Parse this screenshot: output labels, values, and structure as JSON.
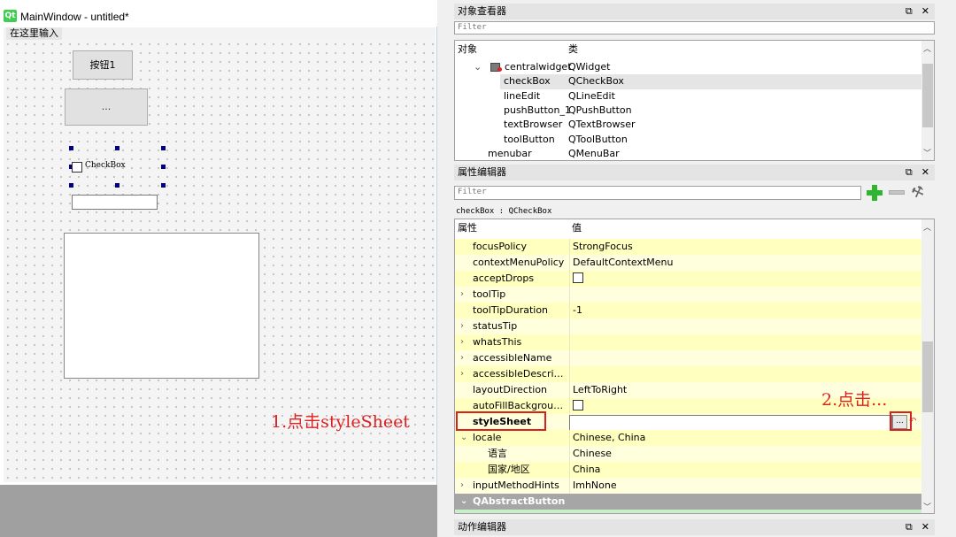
{
  "form_window": {
    "title": "MainWindow - untitled*",
    "logo": "Qt",
    "menu_placeholder": "在这里输入",
    "widgets": {
      "push_button_label": "按钮1",
      "tool_button_label": "...",
      "checkbox_label": "CheckBox"
    }
  },
  "annotations": {
    "step1": "1.点击styleSheet",
    "step2": "2.点击..."
  },
  "object_inspector": {
    "title": "对象查看器",
    "filter_placeholder": "Filter",
    "col_object": "对象",
    "col_class": "类",
    "rows": [
      {
        "object": "centralwidget",
        "class": "QWidget",
        "level": 1,
        "expanded": true
      },
      {
        "object": "checkBox",
        "class": "QCheckBox",
        "level": 2,
        "selected": true
      },
      {
        "object": "lineEdit",
        "class": "QLineEdit",
        "level": 2
      },
      {
        "object": "pushButton_1",
        "class": "QPushButton",
        "level": 2
      },
      {
        "object": "textBrowser",
        "class": "QTextBrowser",
        "level": 2
      },
      {
        "object": "toolButton",
        "class": "QToolButton",
        "level": 2
      },
      {
        "object": "menubar",
        "class": "QMenuBar",
        "level": 0
      }
    ]
  },
  "property_editor": {
    "title": "属性编辑器",
    "filter_placeholder": "Filter",
    "context": "checkBox : QCheckBox",
    "col_property": "属性",
    "col_value": "值",
    "rows": [
      {
        "name": "focusPolicy",
        "value": "StrongFocus"
      },
      {
        "name": "contextMenuPolicy",
        "value": "DefaultContextMenu"
      },
      {
        "name": "acceptDrops",
        "value": "",
        "checkbox": true
      },
      {
        "name": "toolTip",
        "value": "",
        "expandable": true
      },
      {
        "name": "toolTipDuration",
        "value": "-1"
      },
      {
        "name": "statusTip",
        "value": "",
        "expandable": true
      },
      {
        "name": "whatsThis",
        "value": "",
        "expandable": true
      },
      {
        "name": "accessibleName",
        "value": "",
        "expandable": true
      },
      {
        "name": "accessibleDescripti...",
        "value": "",
        "expandable": true
      },
      {
        "name": "layoutDirection",
        "value": "LeftToRight"
      },
      {
        "name": "autoFillBackground",
        "value": "",
        "checkbox": true
      },
      {
        "name": "styleSheet",
        "value": "",
        "bold": true,
        "highlight": true
      },
      {
        "name": "locale",
        "value": "Chinese, China",
        "expandable": true,
        "expanded": true
      },
      {
        "name": "语言",
        "value": "Chinese",
        "sub": true
      },
      {
        "name": "国家/地区",
        "value": "China",
        "sub": true
      },
      {
        "name": "inputMethodHints",
        "value": "ImhNone",
        "expandable": true
      }
    ],
    "section_header": "QAbstractButton",
    "ellipsis_button": "...",
    "reset_icon": "↶"
  },
  "action_editor": {
    "title": "动作编辑器"
  },
  "colors": {
    "annotation_red": "#e02020",
    "property_yellow": "#ffffbf",
    "selection_gray": "#e5e5e5",
    "section_gray": "#a6a6a6",
    "add_green": "#2fb52f"
  }
}
